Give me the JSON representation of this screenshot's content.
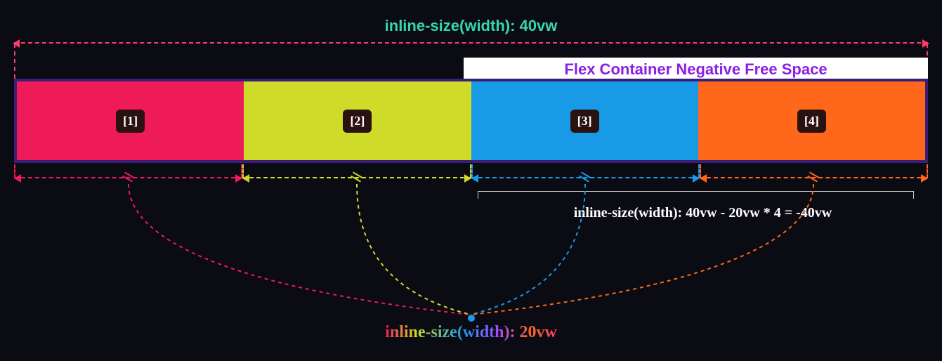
{
  "top_label": "inline-size(width): 40vw",
  "banner_label": "Flex Container Negative Free Space",
  "items": {
    "i1": "[1]",
    "i2": "[2]",
    "i3": "[3]",
    "i4": "[4]"
  },
  "formula_label": "inline-size(width): 40vw - 20vw * 4 = -40vw",
  "bottom_label": "inline-size(width): 20vw",
  "colors": {
    "bg": "#0b0b14",
    "container_border": "#3b1e78",
    "item1": "#ef1a58",
    "item2": "#cedb28",
    "item3": "#189ae6",
    "item4": "#ff671a",
    "top_text": "#36d6b0",
    "banner_text": "#8a1fe6"
  },
  "chart_data": {
    "type": "diagram",
    "title": "Flex Container Negative Free Space",
    "container_width": "40vw",
    "item_width": "20vw",
    "item_count": 4,
    "free_space_formula": "40vw - 20vw * 4",
    "free_space_result": "-40vw",
    "items": [
      "[1]",
      "[2]",
      "[3]",
      "[4]"
    ]
  }
}
